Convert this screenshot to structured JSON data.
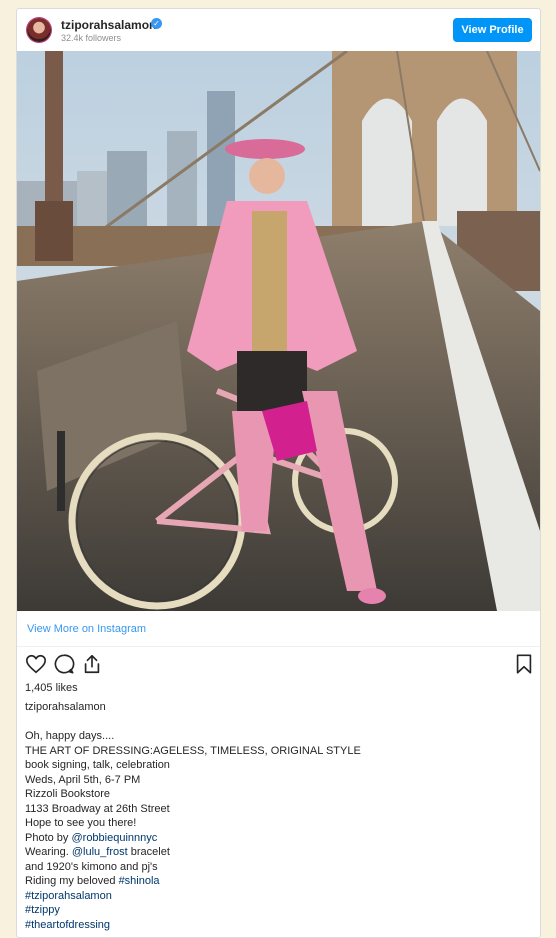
{
  "header": {
    "username": "tziporahsalamon",
    "followers": "32.4k followers",
    "view_profile_label": "View Profile"
  },
  "photo": {
    "alt": "Woman in pink kimono with a pink bicycle on the Brooklyn Bridge"
  },
  "view_more_label": "View More on Instagram",
  "actions": {
    "like_icon": "heart-icon",
    "comment_icon": "comment-icon",
    "share_icon": "share-icon",
    "save_icon": "bookmark-icon"
  },
  "likes": "1,405 likes",
  "caption_username": "tziporahsalamon",
  "caption": {
    "l1": "Oh, happy days....",
    "l2": "THE ART OF DRESSING:AGELESS, TIMELESS, ORIGINAL STYLE",
    "l3": "book signing, talk, celebration",
    "l4": "Weds, April 5th, 6-7 PM",
    "l5": "Rizzoli Bookstore",
    "l6": "1133 Broadway at 26th Street",
    "l7": "Hope to see you there!",
    "l8_prefix": "Photo by ",
    "l8_mention": "@robbiequinnnyc",
    "l9_prefix": "Wearing. ",
    "l9_mention": "@lulu_frost",
    "l9_suffix": " bracelet",
    "l10": "and 1920's kimono and pj's",
    "l11_prefix": "Riding my beloved ",
    "l11_tag": "#shinola",
    "l12": "#tziporahsalamon",
    "l13": "#tzippy",
    "l14": "#theartofdressing"
  },
  "colors": {
    "accent": "#0095f6",
    "link": "#3897f0",
    "background": "#f7f1de"
  }
}
